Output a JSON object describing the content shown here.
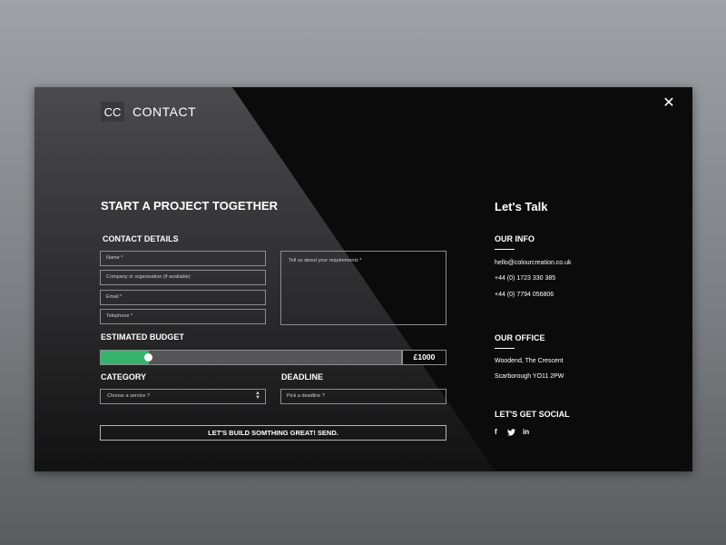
{
  "header": {
    "logo_mark": "CC",
    "logo_text": "CONTACT"
  },
  "form": {
    "title": "START A PROJECT TOGETHER",
    "contact_details_label": "CONTACT DETAILS",
    "name_placeholder": "Name *",
    "company_placeholder": "Company or organisation (if available)",
    "email_placeholder": "Email *",
    "telephone_placeholder": "Telephone *",
    "requirements_placeholder": "Tell us about your requirements *",
    "budget_label": "ESTIMATED BUDGET",
    "budget_value": "£1000",
    "budget_fraction": 0.16,
    "category_label": "CATEGORY",
    "category_placeholder": "Choose a service ?",
    "deadline_label": "DEADLINE",
    "deadline_placeholder": "Pick a deadline ?",
    "send_label": "LET'S BUILD SOMTHING GREAT!  SEND."
  },
  "sidebar": {
    "title": "Let's Talk",
    "info_label": "OUR INFO",
    "email": "hello@colourcreation.co.uk",
    "phone1": "+44 (0) 1723 330 385",
    "phone2": "+44 (0) 7794 056806",
    "office_label": "OUR OFFICE",
    "address1": "Woodend, The Crescent",
    "address2": "Scarborough  YO11 2PW",
    "social_label": "LET'S GET SOCIAL",
    "social_icons": [
      "facebook-icon",
      "twitter-icon",
      "linkedin-icon"
    ]
  },
  "colors": {
    "accent": "#36b46e",
    "background": "#0b0b0c",
    "panel_light": "#4a4a4c"
  }
}
